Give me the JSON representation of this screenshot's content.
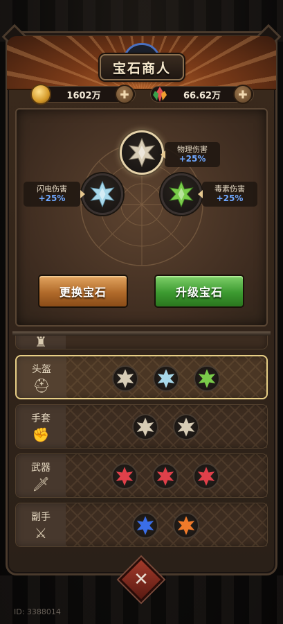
{
  "header": {
    "title": "宝石商人"
  },
  "resources": {
    "gold": {
      "value": "1602万",
      "icon": "coin-icon"
    },
    "gem": {
      "value": "66.62万",
      "icon": "crystal-icon"
    }
  },
  "sockets": [
    {
      "name": "物理伤害",
      "bonus": "+25%",
      "color": "#d8cdb6"
    },
    {
      "name": "闪电伤害",
      "bonus": "+25%",
      "color": "#a8d8ea"
    },
    {
      "name": "毒素伤害",
      "bonus": "+25%",
      "color": "#7acc4a"
    }
  ],
  "buttons": {
    "swap": "更换宝石",
    "upgrade": "升级宝石"
  },
  "equipment": [
    {
      "label": "头盔",
      "icon": "helmet-icon",
      "gems": [
        "#d8cdb6",
        "#a8d8ea",
        "#7acc4a"
      ],
      "selected": true
    },
    {
      "label": "手套",
      "icon": "glove-icon",
      "gems": [
        "#d8cdb6",
        "#d8cdb6"
      ]
    },
    {
      "label": "武器",
      "icon": "sword-icon",
      "gems": [
        "#e0404a",
        "#e0404a",
        "#e0404a"
      ]
    },
    {
      "label": "副手",
      "icon": "shield-icon",
      "gems": [
        "#3a6ee8",
        "#f07a2a"
      ]
    }
  ],
  "footer": {
    "id_text": "ID: 3388014"
  }
}
